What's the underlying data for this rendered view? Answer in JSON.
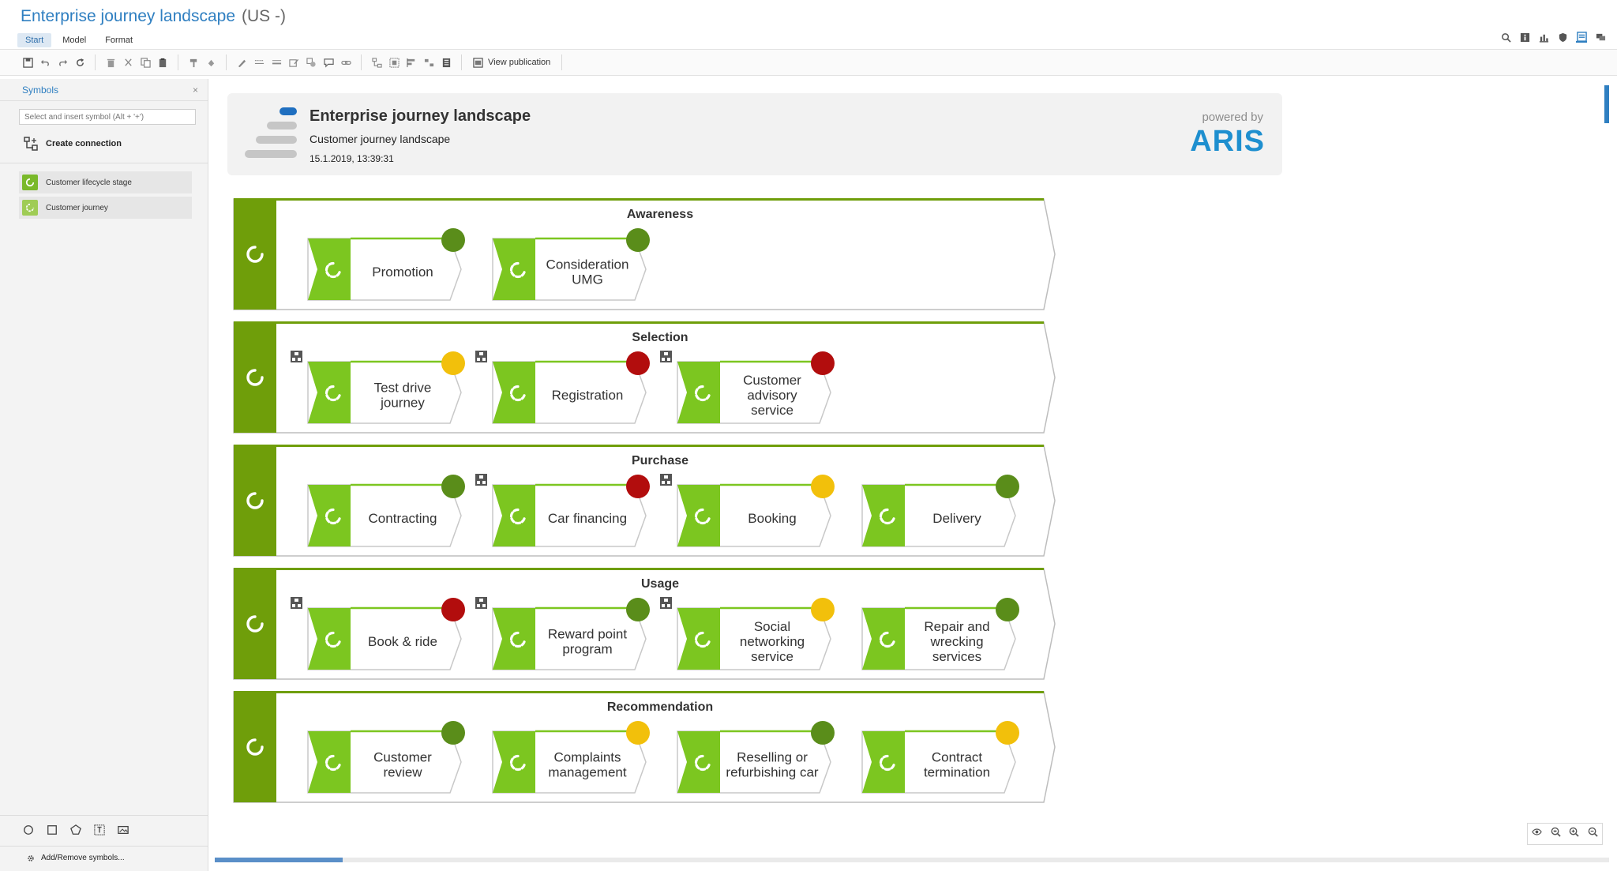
{
  "app": {
    "title": "Enterprise journey landscape",
    "language": "(US -)",
    "tabs": [
      "Start",
      "Model",
      "Format"
    ],
    "active_tab": "Start"
  },
  "toolbar": {
    "view_publication": "View publication"
  },
  "symbols_panel": {
    "title": "Symbols",
    "close": "×",
    "search_placeholder": "Select and insert symbol (Alt + '+')",
    "create_connection": "Create connection",
    "items": [
      {
        "label": "Customer lifecycle stage"
      },
      {
        "label": "Customer journey"
      }
    ],
    "add_remove": "Add/Remove symbols..."
  },
  "model_header": {
    "title": "Enterprise journey landscape",
    "type": "Customer journey landscape",
    "date": "15.1.2019, 13:39:31",
    "powered_by": "powered by",
    "brand": "ARIS"
  },
  "colors": {
    "stage_green": "#6f9e0a",
    "journey_green": "#7cc620",
    "status_green": "#5a8d1a",
    "status_yellow": "#f2c00b",
    "status_red": "#b20d0d",
    "accent_blue": "#2f7fc1"
  },
  "stages": [
    {
      "name": "Awareness",
      "journeys": [
        {
          "label": [
            "Promotion"
          ],
          "status": "green",
          "subprocess": false
        },
        {
          "label": [
            "Consideration",
            "UMG"
          ],
          "status": "green",
          "subprocess": false
        }
      ]
    },
    {
      "name": "Selection",
      "journeys": [
        {
          "label": [
            "Test drive",
            "journey"
          ],
          "status": "yellow",
          "subprocess": true
        },
        {
          "label": [
            "Registration"
          ],
          "status": "red",
          "subprocess": true
        },
        {
          "label": [
            "Customer",
            "advisory",
            "service"
          ],
          "status": "red",
          "subprocess": true
        }
      ]
    },
    {
      "name": "Purchase",
      "journeys": [
        {
          "label": [
            "Contracting"
          ],
          "status": "green",
          "subprocess": false
        },
        {
          "label": [
            "Car financing"
          ],
          "status": "red",
          "subprocess": true
        },
        {
          "label": [
            "Booking"
          ],
          "status": "yellow",
          "subprocess": true
        },
        {
          "label": [
            "Delivery"
          ],
          "status": "green",
          "subprocess": false
        }
      ]
    },
    {
      "name": "Usage",
      "journeys": [
        {
          "label": [
            "Book & ride"
          ],
          "status": "red",
          "subprocess": true
        },
        {
          "label": [
            "Reward point",
            "program"
          ],
          "status": "green",
          "subprocess": true
        },
        {
          "label": [
            "Social",
            "networking",
            "service"
          ],
          "status": "yellow",
          "subprocess": true
        },
        {
          "label": [
            "Repair and",
            "wrecking",
            "services"
          ],
          "status": "green",
          "subprocess": false
        }
      ]
    },
    {
      "name": "Recommendation",
      "journeys": [
        {
          "label": [
            "Customer",
            "review"
          ],
          "status": "green",
          "subprocess": false
        },
        {
          "label": [
            "Complaints",
            "management"
          ],
          "status": "yellow",
          "subprocess": false
        },
        {
          "label": [
            "Reselling or",
            "refurbishing car"
          ],
          "status": "green",
          "subprocess": false
        },
        {
          "label": [
            "Contract",
            "termination"
          ],
          "status": "yellow",
          "subprocess": false
        }
      ]
    }
  ]
}
